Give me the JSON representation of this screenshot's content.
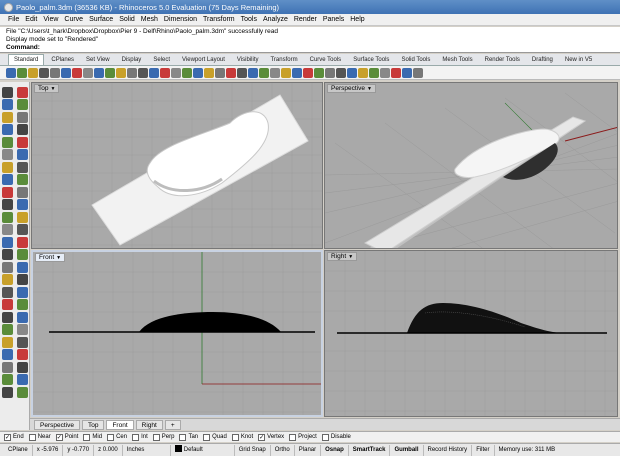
{
  "window": {
    "title": "Paolo_palm.3dm (36536 KB) - Rhinoceros 5.0 Evaluation (75 Days Remaining)"
  },
  "menu": [
    "File",
    "Edit",
    "View",
    "Curve",
    "Surface",
    "Solid",
    "Mesh",
    "Dimension",
    "Transform",
    "Tools",
    "Analyze",
    "Render",
    "Panels",
    "Help"
  ],
  "command_area": {
    "line1": "File \"C:\\Users\\t_hark\\Dropbox\\Dropbox\\Pier 9 - Delf\\Rhino\\Paolo_palm.3dm\" successfully read",
    "line2": "Display mode set to \"Rendered\"",
    "prompt": "Command:"
  },
  "toolbar_tabs": [
    "Standard",
    "CPlanes",
    "Set View",
    "Display",
    "Select",
    "Viewport Layout",
    "Visibility",
    "Transform",
    "Curve Tools",
    "Surface Tools",
    "Solid Tools",
    "Mesh Tools",
    "Render Tools",
    "Drafting",
    "New in V5"
  ],
  "active_toolbar_tab": "Standard",
  "viewports": {
    "top": "Top",
    "perspective": "Perspective",
    "front": "Front",
    "right": "Right"
  },
  "viewport_tabs": [
    "Perspective",
    "Top",
    "Front",
    "Right",
    "+"
  ],
  "active_viewport_tab": "Front",
  "osnaps": [
    {
      "label": "End",
      "checked": true
    },
    {
      "label": "Near",
      "checked": false
    },
    {
      "label": "Point",
      "checked": true
    },
    {
      "label": "Mid",
      "checked": false
    },
    {
      "label": "Cen",
      "checked": false
    },
    {
      "label": "Int",
      "checked": false
    },
    {
      "label": "Perp",
      "checked": false
    },
    {
      "label": "Tan",
      "checked": false
    },
    {
      "label": "Quad",
      "checked": false
    },
    {
      "label": "Knot",
      "checked": false
    },
    {
      "label": "Vertex",
      "checked": true
    },
    {
      "label": "Project",
      "checked": false
    },
    {
      "label": "Disable",
      "checked": false
    }
  ],
  "status": {
    "cplane": "CPlane",
    "x": "x -5.976",
    "y": "y -0.770",
    "z": "z 0.000",
    "units": "Inches",
    "layer": "Default",
    "grid_snap": "Grid Snap",
    "ortho": "Ortho",
    "planar": "Planar",
    "osnap": "Osnap",
    "smarttrack": "SmartTrack",
    "gumball": "Gumball",
    "record_history": "Record History",
    "filter": "Filter",
    "memory": "Memory use: 311 MB"
  },
  "colors": {
    "viewport_bg": "#a9a9a9",
    "grid": "#9c9c9c",
    "x_axis": "#8b1a1a",
    "y_axis": "#2f7a2f",
    "active_label": "#e6edf7"
  }
}
